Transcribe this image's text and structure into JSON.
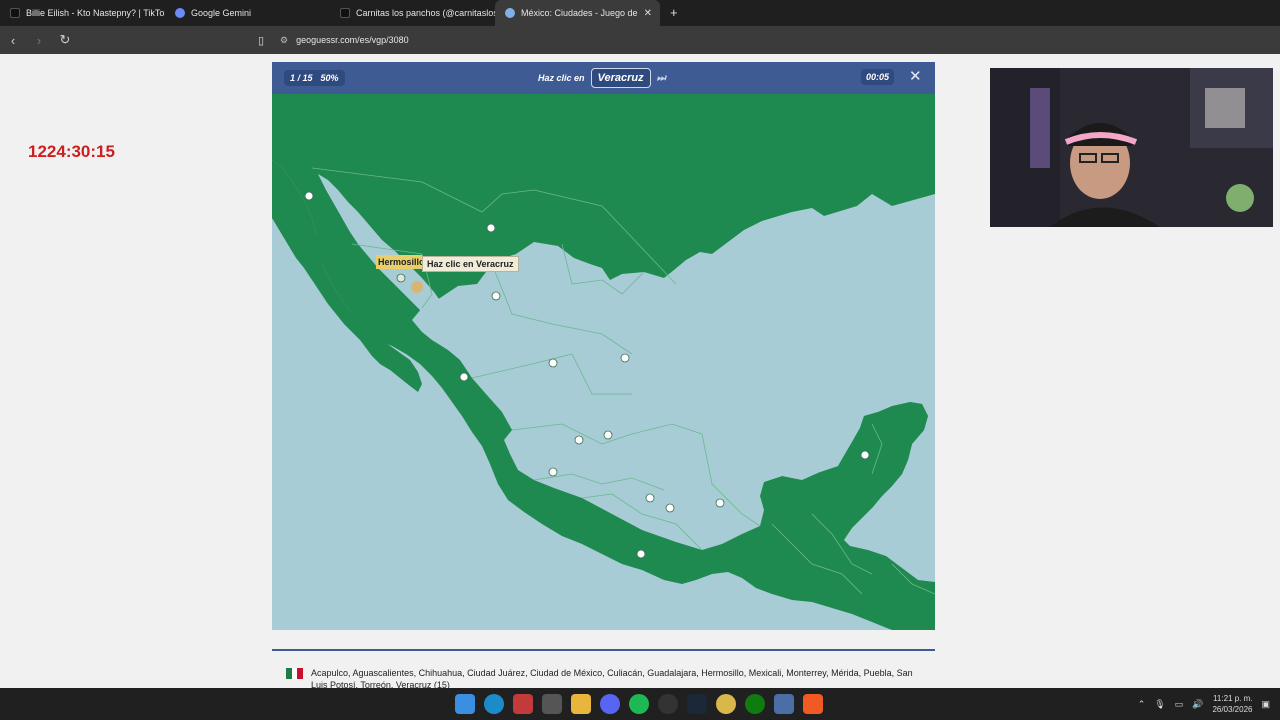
{
  "browser": {
    "tabs": [
      {
        "title": "Billie Eilish - Kto Nastepny? | TikTok",
        "icon": "tiktok-icon",
        "active": false
      },
      {
        "title": "Google Gemini",
        "icon": "gemini-icon",
        "active": false
      },
      {
        "title": "Carnitas los panchos (@carnitaslospa",
        "icon": "tiktok-icon",
        "active": false
      },
      {
        "title": "México: Ciudades - Juego de",
        "icon": "geoguessr-icon",
        "active": true
      }
    ],
    "new_tab": "+",
    "tab_close": "✕",
    "url": "geoguessr.com/es/vgp/3080"
  },
  "overlay_timer": "1224:30:15",
  "game": {
    "progress": "1 / 15",
    "score": "50%",
    "prompt_label": "Haz clic en",
    "target_city": "Veracruz",
    "skip": "⏭",
    "time": "00:05",
    "close": "✕"
  },
  "map": {
    "label": "Hermosillo",
    "tooltip": "Haz clic en Veracruz",
    "colors": {
      "land": "#1f8a50",
      "sea": "#a7ccd6",
      "border": "#63b08a"
    }
  },
  "city_list": "Acapulco, Aguascalientes, Chihuahua, Ciudad Juárez, Ciudad de México, Culiacán, Guadalajara, Hermosillo, Mexicali, Monterrey, Mérida, Puebla, San Luis Potosí, Torreón, Veracruz (15)",
  "taskbar": {
    "time": "11:21 p. m.",
    "date": "26/03/2026"
  }
}
